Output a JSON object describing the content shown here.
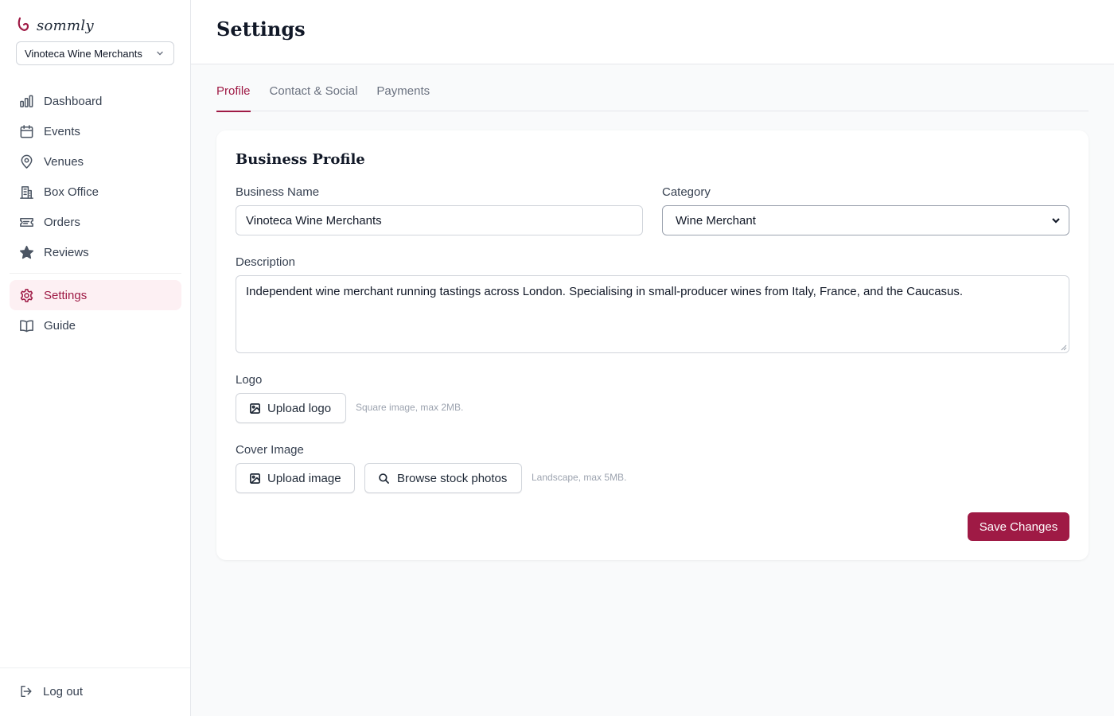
{
  "app": {
    "logo_text": "sommly",
    "organization": "Vinoteca Wine Merchants"
  },
  "sidebar": {
    "items": [
      {
        "label": "Dashboard",
        "icon": "bar-chart-icon"
      },
      {
        "label": "Events",
        "icon": "calendar-icon"
      },
      {
        "label": "Venues",
        "icon": "map-pin-icon"
      },
      {
        "label": "Box Office",
        "icon": "building-icon"
      },
      {
        "label": "Orders",
        "icon": "ticket-icon"
      },
      {
        "label": "Reviews",
        "icon": "star-icon"
      }
    ],
    "settings_label": "Settings",
    "guide_label": "Guide",
    "logout_label": "Log out"
  },
  "header": {
    "title": "Settings"
  },
  "tabs": [
    {
      "label": "Profile",
      "active": true
    },
    {
      "label": "Contact & Social",
      "active": false
    },
    {
      "label": "Payments",
      "active": false
    }
  ],
  "profile": {
    "card_title": "Business Profile",
    "business_name_label": "Business Name",
    "business_name_value": "Vinoteca Wine Merchants",
    "category_label": "Category",
    "category_value": "Wine Merchant",
    "description_label": "Description",
    "description_value": "Independent wine merchant running tastings across London. Specialising in small-producer wines from Italy, France, and the Caucasus.",
    "logo_label": "Logo",
    "upload_logo_button": "Upload logo",
    "logo_hint": "Square image, max 2MB.",
    "cover_label": "Cover Image",
    "upload_image_button": "Upload image",
    "browse_stock_button": "Browse stock photos",
    "cover_hint": "Landscape, max 5MB.",
    "save_button": "Save Changes"
  },
  "colors": {
    "accent": "#9f1a45",
    "active_nav_bg": "#fdf0f3"
  }
}
